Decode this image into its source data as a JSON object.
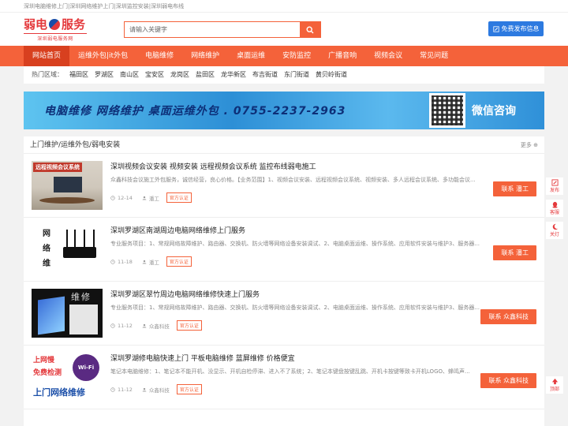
{
  "topbar": {
    "text": "深圳电脑维修上门|深圳网络维护上门|深圳监控安装|深圳弱电布线"
  },
  "logo": {
    "main_left": "弱电",
    "main_right": "服务",
    "sub": "深圳弱电服务网"
  },
  "search": {
    "placeholder": "请输入关键字"
  },
  "header": {
    "publish_label": "免费发布信息"
  },
  "nav": {
    "items": [
      {
        "label": "网站首页"
      },
      {
        "label": "运维外包|it外包"
      },
      {
        "label": "电脑维修"
      },
      {
        "label": "网络维护"
      },
      {
        "label": "桌面运维"
      },
      {
        "label": "安防监控"
      },
      {
        "label": "广播音响"
      },
      {
        "label": "视频会议"
      },
      {
        "label": "常见问题"
      }
    ]
  },
  "hot": {
    "label": "热门区域：",
    "items": [
      "福田区",
      "罗湖区",
      "南山区",
      "宝安区",
      "龙岗区",
      "盐田区",
      "龙华新区",
      "布吉街道",
      "东门街道",
      "黄贝岭街道"
    ]
  },
  "banner": {
    "text": "电脑维修  网络维护  桌面运维外包 . 0755-2237-2963",
    "consult": "微信咨询"
  },
  "list": {
    "heading": "上门维护/运维外包/弱电安装",
    "more": "更多",
    "items": [
      {
        "thumb_label": "远程视频会议系统",
        "title": "深圳视频会议安装 视频安装 远程视频会议系统 监控布线弱电施工",
        "desc": "众鑫科技会议施工外包服务，诚信经营，良心价格。【业务范围】1、视频会议安装、远程视频会议系统、视频安装、多人远程会议系统、多功能会议...",
        "date": "12-14",
        "user": "潘工",
        "badge": "官方认证",
        "button": "联系 潘工"
      },
      {
        "thumb_label": "网络维护上门",
        "title": "深圳罗湖区南湖周边电脑网络维修上门服务",
        "desc": "专业服务项目：1、常规网络故障维护、路由器、交换机、防火墙等网络设备安装调试、2、电脑桌面运维、操作系统、应用软件安装与维护3、服务器...",
        "date": "11-18",
        "user": "潘工",
        "badge": "官方认证",
        "button": "联系 潘工"
      },
      {
        "thumb_label": "维修",
        "title": "深圳罗湖区翠竹周边电脑网络维修快速上门服务",
        "desc": "专业服务项目：1、常规网络故障维护、路由器、交换机、防火墙等网络设备安装调试、2、电脑桌面运维、操作系统、应用软件安装与维护3、服务器...",
        "date": "11-12",
        "user": "众鑫科技",
        "badge": "官方认证",
        "button": "联系 众鑫科技"
      },
      {
        "thumb_label_1": "上网慢",
        "thumb_label_2": "免费检测",
        "thumb_label_3": "上门网络维修",
        "thumb_wifi": "Wi-Fi",
        "title": "深圳罗湖修电脑快速上门 平板电脑维修 蓝屏维修 价格便宜",
        "desc": "笔记本电脑维修：1、笔记本不能开机、没显示、开机自检停滞、进入不了系统；2、笔记本键盘按键乱跳、开机卡按键等致卡开机LOGO、蜂鸣声...",
        "date": "11-12",
        "user": "众鑫科技",
        "badge": "官方认证",
        "button": "联系 众鑫科技"
      }
    ]
  },
  "sidebar": {
    "items": [
      {
        "label": "发布",
        "icon": "edit-icon"
      },
      {
        "label": "客服",
        "icon": "qq-icon"
      },
      {
        "label": "关灯",
        "icon": "moon-icon"
      },
      {
        "label": "顶部",
        "icon": "arrow-up-icon"
      }
    ]
  },
  "colors": {
    "accent": "#f4623a",
    "nav_active": "#d8401f",
    "publish": "#2d7ae0",
    "brand_red": "#e4393c"
  }
}
